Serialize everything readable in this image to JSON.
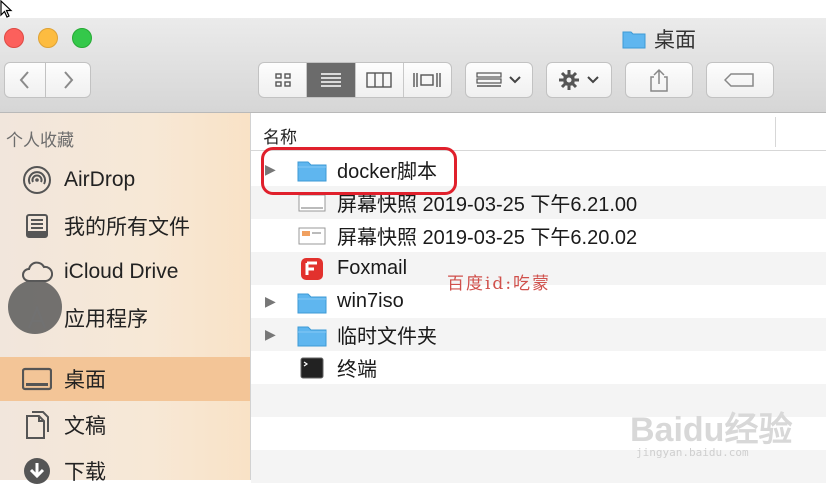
{
  "window": {
    "title": "桌面"
  },
  "toolbar": {
    "back_icon": "chevron-left",
    "forward_icon": "chevron-right",
    "views": [
      "icon-view",
      "list-view",
      "column-view",
      "cover-flow-view"
    ],
    "active_view": "list-view"
  },
  "sidebar": {
    "header": "个人收藏",
    "items": [
      {
        "label": "AirDrop",
        "icon": "airdrop-icon"
      },
      {
        "label": "我的所有文件",
        "icon": "all-files-icon"
      },
      {
        "label": "iCloud Drive",
        "icon": "cloud-icon"
      },
      {
        "label": "应用程序",
        "icon": "applications-icon"
      },
      {
        "label": "桌面",
        "icon": "desktop-icon",
        "selected": true
      },
      {
        "label": "文稿",
        "icon": "documents-icon"
      },
      {
        "label": "下载",
        "icon": "download-icon"
      }
    ]
  },
  "list": {
    "column_name": "名称",
    "rows": [
      {
        "name": "docker脚本",
        "type": "folder",
        "expandable": true
      },
      {
        "name": "屏幕快照 2019-03-25 下午6.21.00",
        "type": "screenshot",
        "expandable": false
      },
      {
        "name": "屏幕快照 2019-03-25 下午6.20.02",
        "type": "screenshot",
        "expandable": false
      },
      {
        "name": "Foxmail",
        "type": "app",
        "expandable": false
      },
      {
        "name": "win7iso",
        "type": "folder",
        "expandable": true
      },
      {
        "name": "临时文件夹",
        "type": "folder",
        "expandable": true
      },
      {
        "name": "终端",
        "type": "terminal",
        "expandable": false
      }
    ]
  },
  "watermark": {
    "text": "百度id:吃蒙",
    "brand": "Baidu经验",
    "url": "jingyan.baidu.com"
  },
  "colors": {
    "selection": "#f3c597",
    "folder": "#5fb6ef",
    "highlight_border": "#e0202c"
  }
}
